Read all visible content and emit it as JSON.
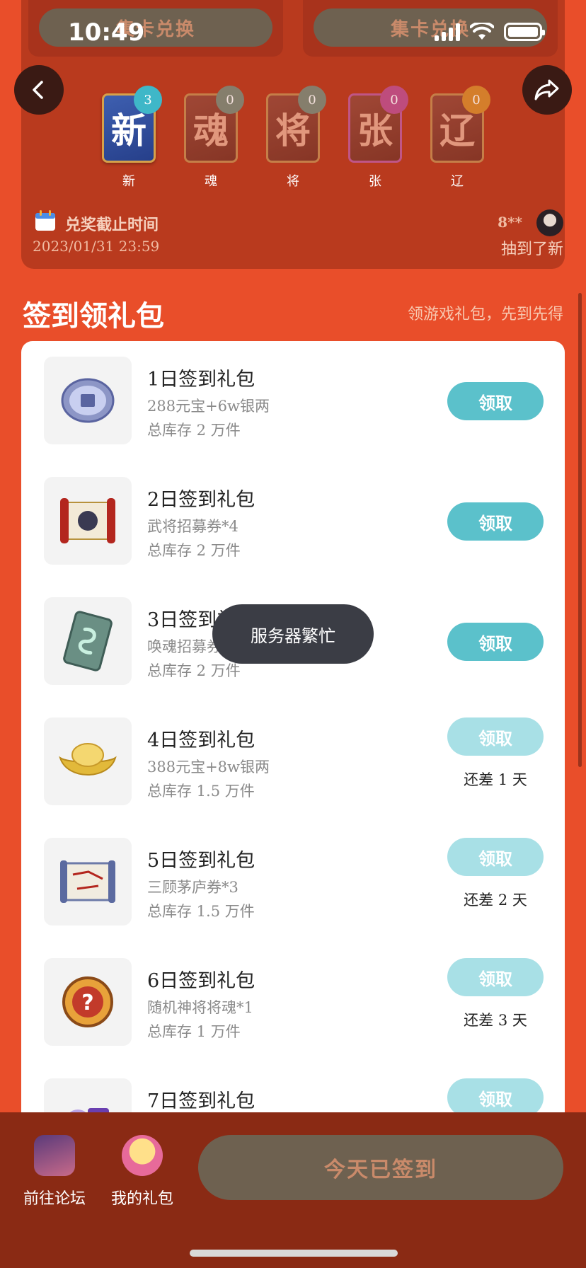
{
  "status_bar": {
    "time": "10:49"
  },
  "top": {
    "exchange_left": "集卡兑换",
    "exchange_right": "集卡兑换",
    "cards": [
      {
        "char": "新",
        "label": "新",
        "count": "3",
        "badge_color": "#3fb7c8",
        "active": true
      },
      {
        "char": "魂",
        "label": "魂",
        "count": "0",
        "badge_color": "#7d8a7a",
        "active": false
      },
      {
        "char": "将",
        "label": "将",
        "count": "0",
        "badge_color": "#7d8a7a",
        "active": false
      },
      {
        "char": "张",
        "label": "张",
        "count": "0",
        "badge_color": "#c0508e",
        "active": false
      },
      {
        "char": "辽",
        "label": "辽",
        "count": "0",
        "badge_color": "#d98a2e",
        "active": false
      }
    ],
    "deadline_label": "兑奖截止时间",
    "deadline_date": "2023/01/31 23:59",
    "winner_name": "8**",
    "winner_text": "抽到了新"
  },
  "section": {
    "title": "签到领礼包",
    "subtitle": "领游戏礼包，先到先得"
  },
  "gifts": [
    {
      "title": "1日签到礼包",
      "desc": "288元宝+6w银两",
      "stock": "总库存 2 万件",
      "button": "领取",
      "available": true,
      "remain": "",
      "icon": "coin-icon"
    },
    {
      "title": "2日签到礼包",
      "desc": "武将招募券*4",
      "stock": "总库存 2 万件",
      "button": "领取",
      "available": true,
      "remain": "",
      "icon": "scroll-icon"
    },
    {
      "title": "3日签到礼包",
      "desc": "唤魂招募券*2",
      "stock": "总库存 2 万件",
      "button": "领取",
      "available": true,
      "remain": "",
      "icon": "card-ticket-icon"
    },
    {
      "title": "4日签到礼包",
      "desc": "388元宝+8w银两",
      "stock": "总库存 1.5 万件",
      "button": "领取",
      "available": false,
      "remain": "还差 1 天",
      "icon": "gold-ingot-icon"
    },
    {
      "title": "5日签到礼包",
      "desc": "三顾茅庐券*3",
      "stock": "总库存 1.5 万件",
      "button": "领取",
      "available": false,
      "remain": "还差 2 天",
      "icon": "book-icon"
    },
    {
      "title": "6日签到礼包",
      "desc": "随机神将将魂*1",
      "stock": "总库存 1 万件",
      "button": "领取",
      "available": false,
      "remain": "还差 3 天",
      "icon": "mystery-orb-icon"
    },
    {
      "title": "7日签到礼包",
      "desc": "",
      "stock": "",
      "button": "领取",
      "available": false,
      "remain": "",
      "icon": "purple-item-icon"
    }
  ],
  "toast": "服务器繁忙",
  "bottom": {
    "forum_label": "前往论坛",
    "mygift_label": "我的礼包",
    "checkin_label": "今天已签到"
  }
}
